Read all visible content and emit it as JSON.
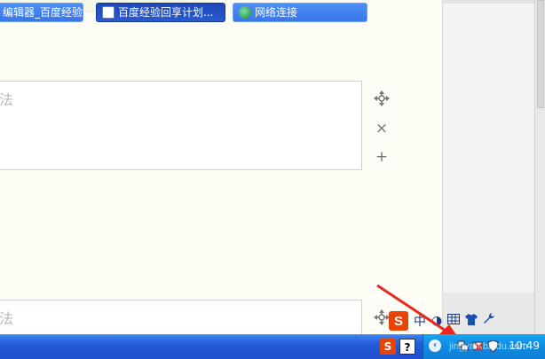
{
  "editor": {
    "step1_placeholder": "法",
    "step2_placeholder": "法"
  },
  "controls": {
    "move": "✥",
    "remove": "×",
    "add": "+"
  },
  "ime_toolbar": {
    "logo": "S",
    "lang": "中",
    "punct": "◑",
    "extra": "⚇"
  },
  "taskbar": {
    "buttons": [
      {
        "label": "编辑器_百度经验",
        "icon": "ie-icon"
      },
      {
        "label": "百度经验回享计划...",
        "icon": "document-icon"
      },
      {
        "label": "网络连接",
        "icon": "network-icon"
      }
    ],
    "quick_launch": [
      {
        "label": "S",
        "icon": "sogou-icon"
      },
      {
        "label": "?",
        "icon": "help-icon"
      }
    ]
  },
  "tray": {
    "expand": "‹",
    "clock": "10:49"
  },
  "watermark": "jingyan.baidu.com",
  "colors": {
    "taskbar_blue": "#2459d8",
    "tray_blue": "#0f8bdf",
    "annotation_red": "#e8281e",
    "sogou_orange": "#e8440a"
  }
}
